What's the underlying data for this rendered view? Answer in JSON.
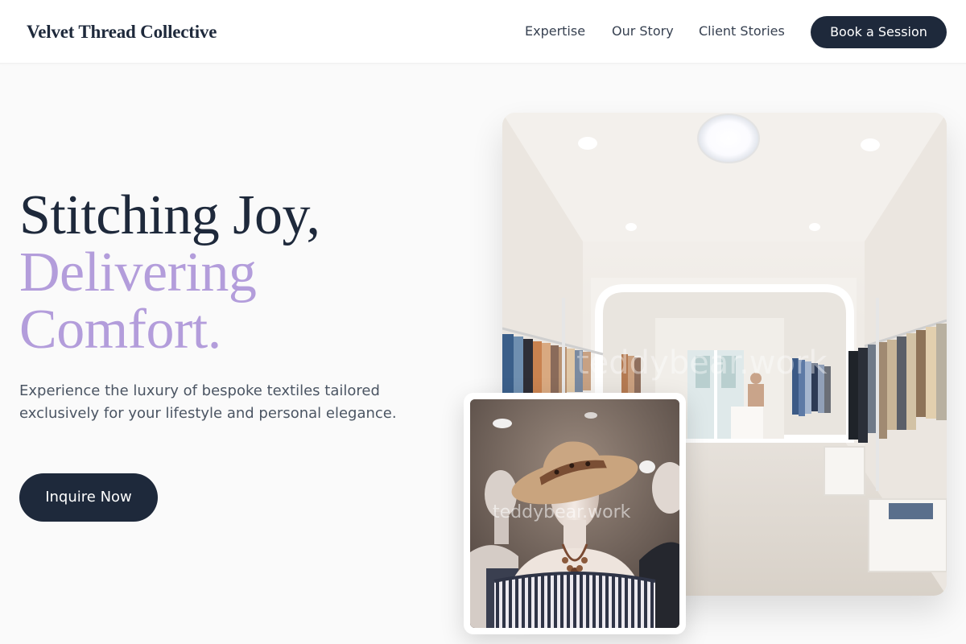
{
  "header": {
    "brand": "Velvet Thread Collective",
    "nav": [
      {
        "label": "Expertise"
      },
      {
        "label": "Our Story"
      },
      {
        "label": "Client Stories"
      }
    ],
    "cta_label": "Book a Session"
  },
  "hero": {
    "headline_line1": "Stitching Joy,",
    "headline_line2": "Delivering",
    "headline_line3": "Comfort.",
    "subtext": "Experience the luxury of bespoke textiles tailored exclusively for your lifestyle and personal elegance.",
    "cta_label": "Inquire Now"
  },
  "images": {
    "store": {
      "subject": "boutique clothing store interior with garment racks",
      "watermark": "teddybear.work"
    },
    "mannequin": {
      "subject": "mannequin wearing straw hat and striped off-shoulder top",
      "watermark": "teddybear.work"
    }
  },
  "colors": {
    "primary": "#1e293b",
    "accent": "#b39ddb",
    "background": "#fafafa",
    "body_text": "#4b5563"
  }
}
